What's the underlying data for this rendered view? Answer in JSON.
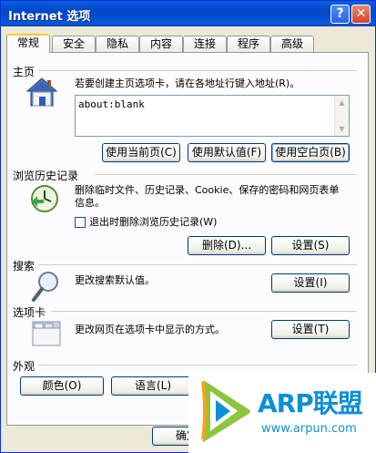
{
  "window": {
    "title": "Internet 选项",
    "help_label": "?",
    "close_label": "✕"
  },
  "tabs": [
    {
      "label": "常规",
      "active": true
    },
    {
      "label": "安全"
    },
    {
      "label": "隐私"
    },
    {
      "label": "内容"
    },
    {
      "label": "连接"
    },
    {
      "label": "程序"
    },
    {
      "label": "高级"
    }
  ],
  "home": {
    "title": "主页",
    "icon": "home-icon",
    "description": "若要创建主页选项卡，请在各地址行键入地址(R)。",
    "url_value": "about:blank",
    "use_current": "使用当前页(C)",
    "use_default": "使用默认值(F)",
    "use_blank": "使用空白页(B)"
  },
  "history": {
    "title": "浏览历史记录",
    "icon": "clock-icon",
    "description": "删除临时文件、历史记录、Cookie、保存的密码和网页表单信息。",
    "checkbox_label": "退出时删除浏览历史记录(W)",
    "checkbox_checked": false,
    "delete_label": "删除(D)...",
    "settings_label": "设置(S)"
  },
  "search": {
    "title": "搜索",
    "icon": "magnifier-icon",
    "description": "更改搜索默认值。",
    "settings_label": "设置(I)"
  },
  "tabs_section": {
    "title": "选项卡",
    "icon": "tabs-window-icon",
    "description": "更改网页在选项卡中显示的方式。",
    "settings_label": "设置(T)"
  },
  "appearance": {
    "title": "外观",
    "colors_label": "颜色(O)",
    "languages_label": "语言(L)"
  },
  "footer": {
    "ok_label": "确定"
  },
  "watermark": {
    "brand": "ARP联盟",
    "url": "www.arpun.com"
  }
}
